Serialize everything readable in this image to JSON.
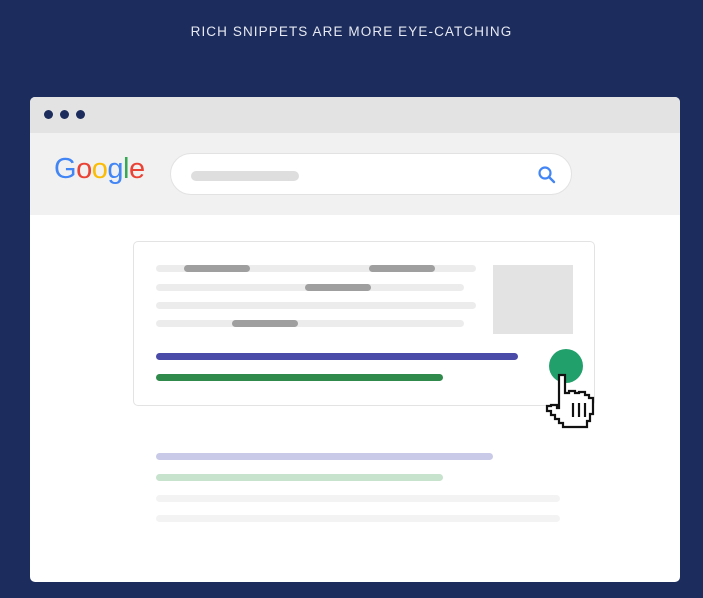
{
  "headline": "RICH SNIPPETS ARE MORE EYE-CATCHING",
  "logo": {
    "letters": [
      {
        "char": "G",
        "color": "#4285f4"
      },
      {
        "char": "o",
        "color": "#ea4335"
      },
      {
        "char": "o",
        "color": "#fbbc05"
      },
      {
        "char": "g",
        "color": "#4285f4"
      },
      {
        "char": "l",
        "color": "#34a853"
      },
      {
        "char": "e",
        "color": "#ea4335"
      }
    ]
  },
  "search": {
    "icon": "search-icon"
  },
  "colors": {
    "background": "#1c2c5c",
    "title_link": "#4a4aa8",
    "url_line": "#2f8a4b",
    "click_indicator": "#22a06b"
  }
}
